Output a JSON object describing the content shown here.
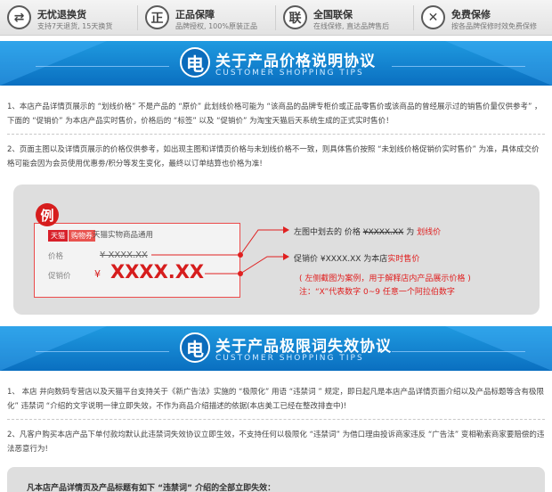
{
  "services": [
    {
      "icon": "exchange-icon",
      "glyph": "⇄",
      "title": "无忧退换货",
      "sub": "支持7天退货, 15天换货"
    },
    {
      "icon": "genuine-icon",
      "glyph": "正",
      "title": "正品保障",
      "sub": "品牌授权, 100%原装正品"
    },
    {
      "icon": "warranty-icon",
      "glyph": "联",
      "title": "全国联保",
      "sub": "在线保修, 直达品牌售后"
    },
    {
      "icon": "wrench-icon",
      "glyph": "✕",
      "title": "免费保修",
      "sub": "按各品牌保修时效免费保修"
    }
  ],
  "section1": {
    "logo": "电",
    "title": "关于产品价格说明协议",
    "subtitle": "CUSTOMER SHOPPING TIPS",
    "para1": "1、本店产品详情页展示的 “划线价格” 不是产品的 “原价” 此划线价格可能为 “该商品的品牌专柜价或正品零售价或该商品的曾经展示过的销售价量仅供参考” ，下面的 “促销价” 为本店产品实时售价，价格后的 “标签” 以及 “促销价” 为淘宝天猫后天系统生成的正式实时售价！",
    "para2": "2、页面主图以及详情页展示的价格仅供参考，如出现主图和详情页价格与未划线价格不一致，则具体售价按照 “未划线价格促销价实时售价” 为准，具体成交价格可能会因为会员使用优惠劵/积分等发生变化，最终以订单结算也价格为准!"
  },
  "example": {
    "badge": "例",
    "tag_tmall": "天猫",
    "tag_shop": "购物券",
    "tag_text": "天猫实物商品通用",
    "price_label": "价格",
    "price_value": "¥ XXXX.XX",
    "promo_label": "促销价",
    "promo_currency": "¥",
    "promo_value": "XXXX.XX",
    "note1_prefix": "左图中划去的  价格 ",
    "note1_price": "¥XXXX.XX",
    "note1_mid": "  为 ",
    "note1_red": "划线价",
    "note2_prefix": "促销价 ¥XXXX.XX  为本店",
    "note2_red": "实时售价",
    "note3": "( 左侧截图为案例，用于解释店内产品展示价格 )",
    "note4": "注：“X”代表数字 0~9 任意一个阿拉伯数字"
  },
  "section2": {
    "logo": "电",
    "title": "关于产品极限词失效协议",
    "subtitle": "CUSTOMER SHOPPING TIPS",
    "para1": "1、  本店 井向数码专营店以及天猫平台支持关于《新广告法》实施的 “极限化” 用语 “违禁词 ” 规定，即日起凡是本店产品详情页面介绍以及产品标题等含有极限化” 违禁词 “介绍的文字说明一律立即失效，不作为商品介绍描述的依据(本店美工已经在整改排查中)!",
    "para2": "2、凡客户购买本店产品下单付款均默认此违禁词失效协议立即生效，不支持任何以极限化 “违禁词” 为借口理由投诉商家违反 “广告法” 变相勒索商家要赔偿的违法恶意行为!",
    "note": "凡本店产品详情页及产品标题有如下 “违禁词” 介绍的全部立即失效："
  }
}
